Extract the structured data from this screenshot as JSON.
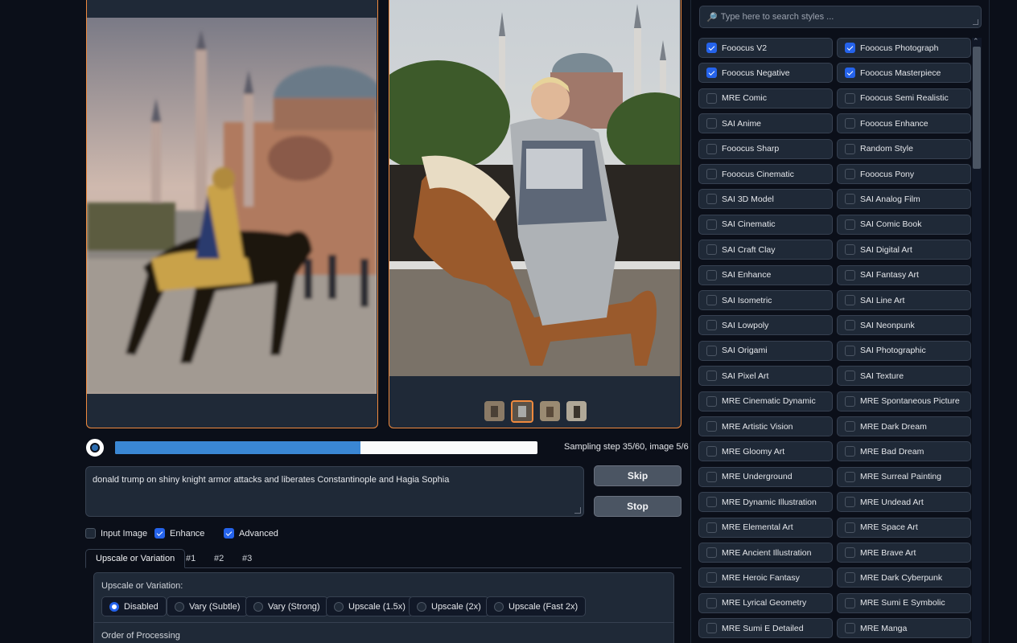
{
  "progress": {
    "value": 0.58,
    "text": "Sampling step 35/60, image 5/6 ..."
  },
  "prompt": {
    "value": "donald trump on shiny knight armor attacks and liberates Constantinople and Hagia Sophia"
  },
  "buttons": {
    "skip": "Skip",
    "stop": "Stop"
  },
  "checks": [
    {
      "label": "Input Image",
      "checked": false
    },
    {
      "label": "Enhance",
      "checked": true
    },
    {
      "label": "Advanced",
      "checked": true
    }
  ],
  "tabs": [
    "Upscale or Variation",
    "#1",
    "#2",
    "#3"
  ],
  "upscale": {
    "label": "Upscale or Variation:",
    "options": [
      {
        "label": "Disabled",
        "selected": true
      },
      {
        "label": "Vary (Subtle)",
        "selected": false
      },
      {
        "label": "Vary (Strong)",
        "selected": false
      },
      {
        "label": "Upscale (1.5x)",
        "selected": false
      },
      {
        "label": "Upscale (2x)",
        "selected": false
      },
      {
        "label": "Upscale (Fast 2x)",
        "selected": false
      }
    ],
    "order_label": "Order of Processing"
  },
  "styles_search": {
    "placeholder": "Type here to search styles ...",
    "icon": "search-icon"
  },
  "styles": [
    {
      "label": "Fooocus V2",
      "checked": true
    },
    {
      "label": "Fooocus Photograph",
      "checked": true
    },
    {
      "label": "Fooocus Negative",
      "checked": true
    },
    {
      "label": "Fooocus Masterpiece",
      "checked": true
    },
    {
      "label": "MRE Comic",
      "checked": false
    },
    {
      "label": "Fooocus Semi Realistic",
      "checked": false
    },
    {
      "label": "SAI Anime",
      "checked": false
    },
    {
      "label": "Fooocus Enhance",
      "checked": false
    },
    {
      "label": "Fooocus Sharp",
      "checked": false
    },
    {
      "label": "Random Style",
      "checked": false
    },
    {
      "label": "Fooocus Cinematic",
      "checked": false
    },
    {
      "label": "Fooocus Pony",
      "checked": false
    },
    {
      "label": "SAI 3D Model",
      "checked": false
    },
    {
      "label": "SAI Analog Film",
      "checked": false
    },
    {
      "label": "SAI Cinematic",
      "checked": false
    },
    {
      "label": "SAI Comic Book",
      "checked": false
    },
    {
      "label": "SAI Craft Clay",
      "checked": false
    },
    {
      "label": "SAI Digital Art",
      "checked": false
    },
    {
      "label": "SAI Enhance",
      "checked": false
    },
    {
      "label": "SAI Fantasy Art",
      "checked": false
    },
    {
      "label": "SAI Isometric",
      "checked": false
    },
    {
      "label": "SAI Line Art",
      "checked": false
    },
    {
      "label": "SAI Lowpoly",
      "checked": false
    },
    {
      "label": "SAI Neonpunk",
      "checked": false
    },
    {
      "label": "SAI Origami",
      "checked": false
    },
    {
      "label": "SAI Photographic",
      "checked": false
    },
    {
      "label": "SAI Pixel Art",
      "checked": false
    },
    {
      "label": "SAI Texture",
      "checked": false
    },
    {
      "label": "MRE Cinematic Dynamic",
      "checked": false
    },
    {
      "label": "MRE Spontaneous Picture",
      "checked": false
    },
    {
      "label": "MRE Artistic Vision",
      "checked": false
    },
    {
      "label": "MRE Dark Dream",
      "checked": false
    },
    {
      "label": "MRE Gloomy Art",
      "checked": false
    },
    {
      "label": "MRE Bad Dream",
      "checked": false
    },
    {
      "label": "MRE Underground",
      "checked": false
    },
    {
      "label": "MRE Surreal Painting",
      "checked": false
    },
    {
      "label": "MRE Dynamic Illustration",
      "checked": false
    },
    {
      "label": "MRE Undead Art",
      "checked": false
    },
    {
      "label": "MRE Elemental Art",
      "checked": false
    },
    {
      "label": "MRE Space Art",
      "checked": false
    },
    {
      "label": "MRE Ancient Illustration",
      "checked": false
    },
    {
      "label": "MRE Brave Art",
      "checked": false
    },
    {
      "label": "MRE Heroic Fantasy",
      "checked": false
    },
    {
      "label": "MRE Dark Cyberpunk",
      "checked": false
    },
    {
      "label": "MRE Lyrical Geometry",
      "checked": false
    },
    {
      "label": "MRE Sumi E Symbolic",
      "checked": false
    },
    {
      "label": "MRE Sumi E Detailed",
      "checked": false
    },
    {
      "label": "MRE Manga",
      "checked": false
    }
  ],
  "gallery": {
    "thumbnail_count": 4,
    "selected_index": 1
  },
  "colors": {
    "accent": "#f08a3e",
    "checkbox": "#2563eb",
    "progress": "#3a87d4",
    "background": "#0b0f19"
  }
}
